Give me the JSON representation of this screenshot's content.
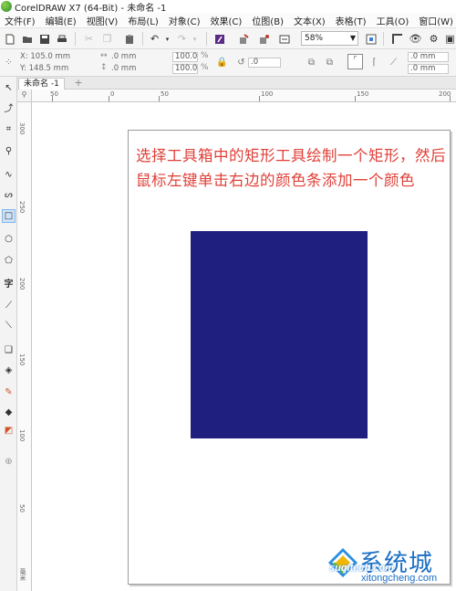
{
  "window": {
    "title": "CorelDRAW X7 (64-Bit) - 未命名 -1"
  },
  "menu": [
    "文件(F)",
    "编辑(E)",
    "视图(V)",
    "布局(L)",
    "对象(C)",
    "效果(C)",
    "位图(B)",
    "文本(X)",
    "表格(T)",
    "工具(O)",
    "窗口(W)"
  ],
  "toolbar": {
    "zoom": "58%"
  },
  "property_bar": {
    "x": "X: 105.0 mm",
    "y": "Y: 148.5 mm",
    "width": ".0 mm",
    "height": ".0 mm",
    "scale_x": "100.0",
    "scale_y": "100.0",
    "percent": "%",
    "angle": ".0",
    "outline_1": ".0 mm",
    "outline_2": ".0 mm"
  },
  "tab": {
    "label": "未命名 -1"
  },
  "ruler": {
    "h_labels": [
      "50",
      "0",
      "50",
      "100",
      "150",
      "200"
    ],
    "v_labels": [
      "300",
      "250",
      "200",
      "150",
      "100",
      "50"
    ],
    "unit": "毫米"
  },
  "annotation": {
    "text": "选择工具箱中的矩形工具绘制一个矩形，然后鼠标左键单击右边的颜色条添加一个颜色"
  },
  "rectangle": {
    "fill_color": "#1e1f7e"
  },
  "watermark": {
    "title": "系统城",
    "url": "xitongcheng.com",
    "overlay": "suqitech.com"
  },
  "colors": {
    "accent": "#e04038",
    "rect": "#1e1f7e",
    "brand": "#1a6fc4"
  }
}
